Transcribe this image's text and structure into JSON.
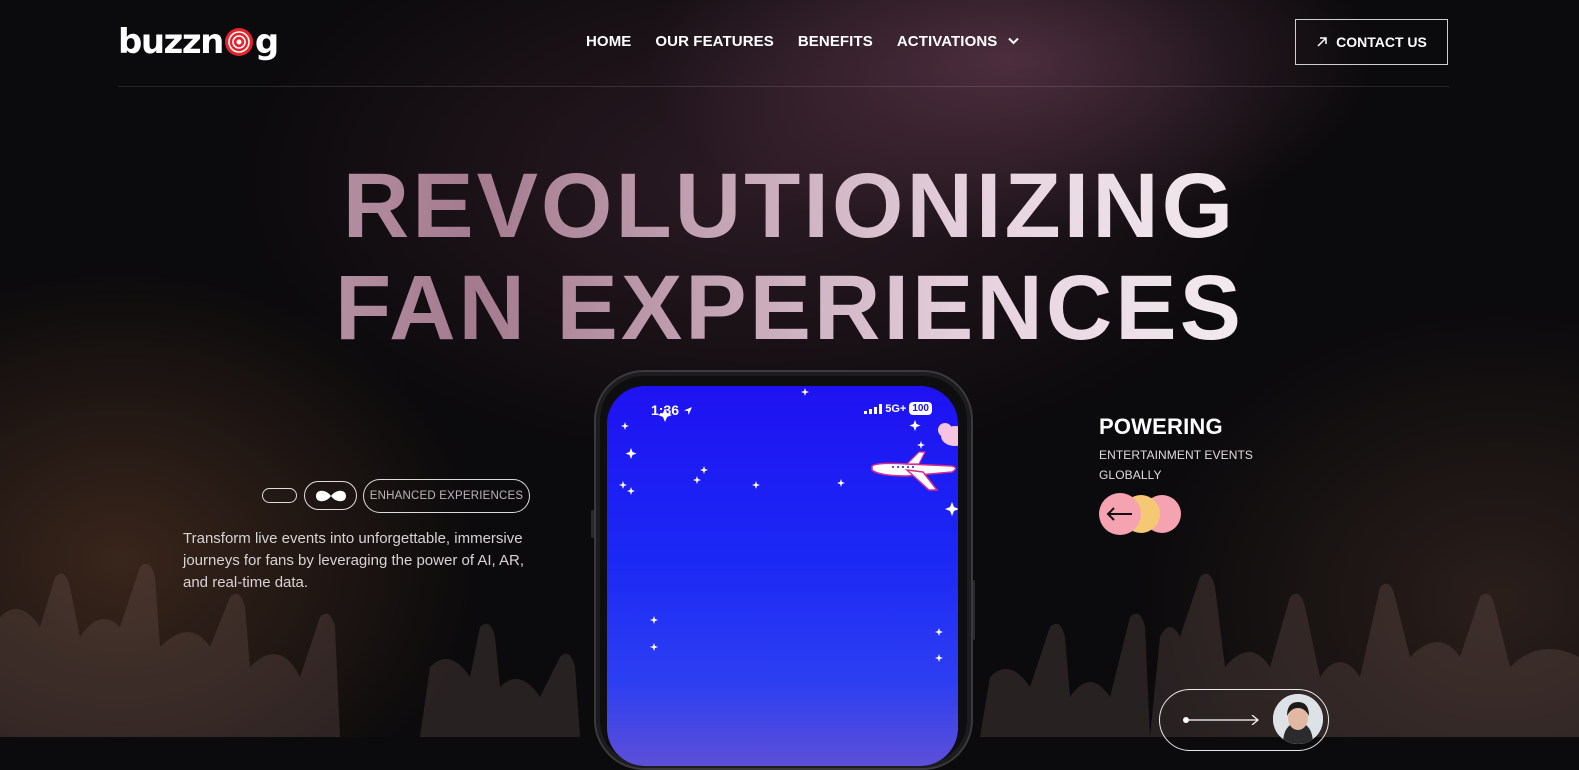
{
  "brand": {
    "name_part1": "buzzn",
    "name_part2": "g"
  },
  "nav": {
    "items": [
      {
        "label": "HOME"
      },
      {
        "label": "OUR FEATURES"
      },
      {
        "label": "BENEFITS"
      },
      {
        "label": "ACTIVATIONS",
        "has_dropdown": true
      }
    ],
    "contact_label": "CONTACT US"
  },
  "hero": {
    "headline_line1": "REVOLUTIONIZING",
    "headline_line2": "FAN EXPERIENCES",
    "tag_label": "ENHANCED EXPERIENCES",
    "description": "Transform live events into unforgettable, immersive journeys for fans by leveraging the power of AI, AR, and real-time data."
  },
  "phone": {
    "time": "1:36",
    "network": "5G+",
    "battery": "100"
  },
  "powering": {
    "title": "POWERING",
    "subtitle": "ENTERTAINMENT EVENTS GLOBALLY"
  },
  "colors": {
    "accent_pink": "#f6a3b1",
    "accent_yellow": "#f5c873",
    "logo_red": "#e5242c",
    "screen_blue": "#1f12f2"
  },
  "icons": {
    "contact": "arrow-up-right-icon",
    "dropdown": "chevron-down-icon",
    "powering": "arrow-left-icon",
    "cta": "arrow-right-icon"
  }
}
